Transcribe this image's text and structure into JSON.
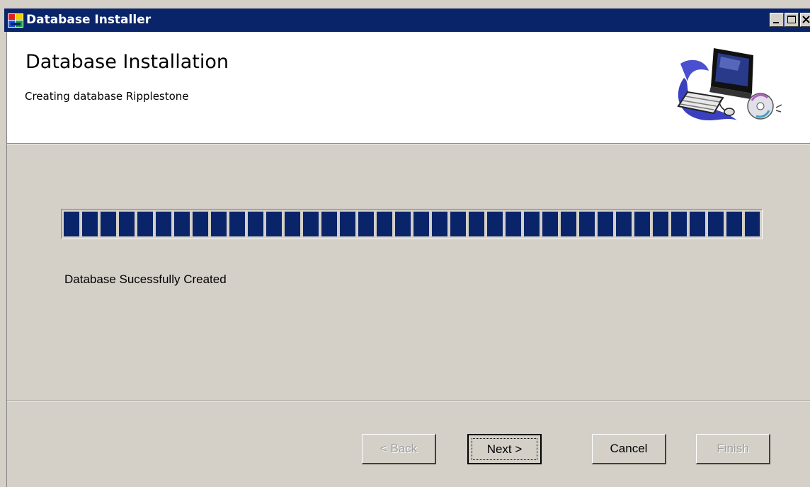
{
  "window": {
    "title": "Database Installer",
    "controls": [
      "minimize-icon",
      "maximize-icon",
      "close-icon"
    ]
  },
  "header": {
    "title": "Database Installation",
    "subtitle": "Creating database Ripplestone",
    "artwork": "computer-cd-clipart"
  },
  "progress": {
    "value_percent": 100
  },
  "status": {
    "message": "Database Sucessfully Created"
  },
  "buttons": {
    "back": "< Back",
    "next": "Next >",
    "cancel": "Cancel",
    "finish": "Finish"
  },
  "colors": {
    "titlebar": "#0a246a",
    "progress_fill": "#0a246a",
    "face": "#d4d0c8"
  }
}
